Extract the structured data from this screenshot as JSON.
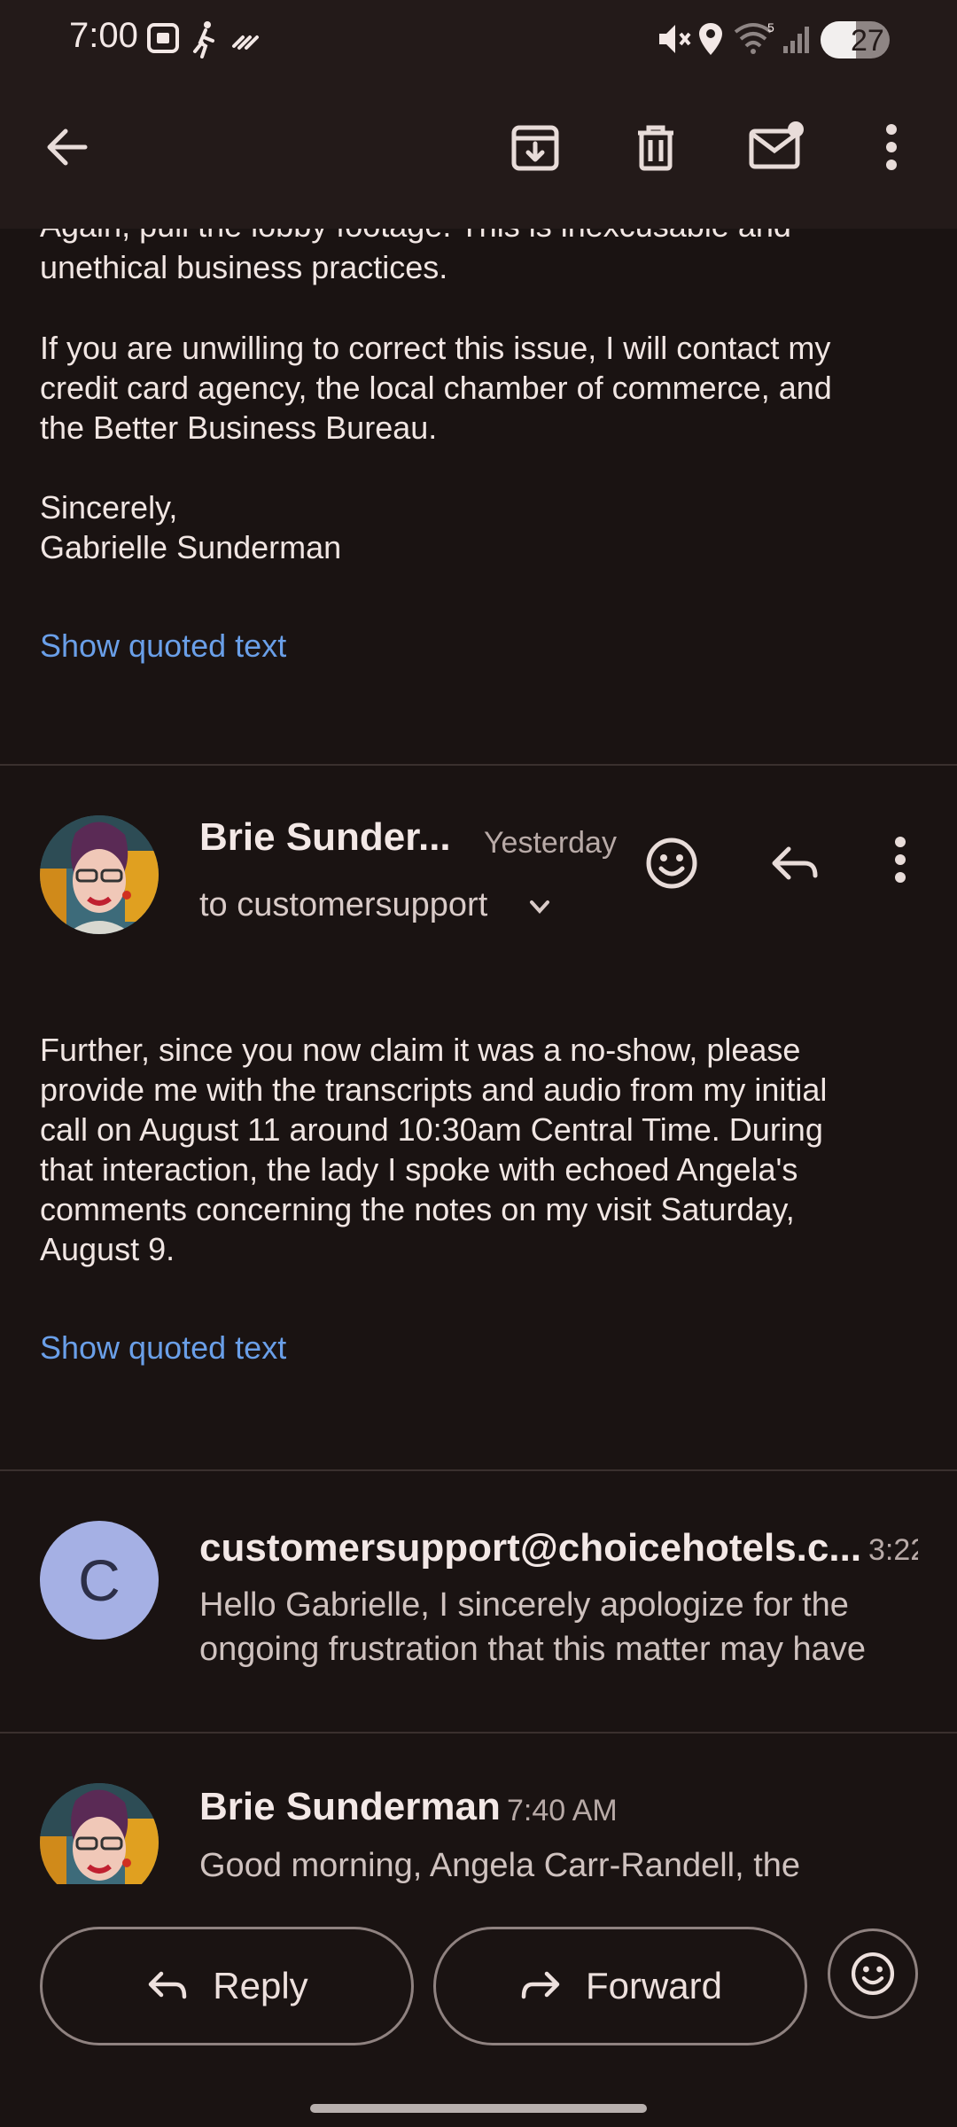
{
  "status_bar": {
    "time": "7:00",
    "battery_level": "27",
    "wifi_label": "5"
  },
  "toolbar": {
    "back_icon": "arrow-left-icon",
    "archive_icon": "archive-icon",
    "delete_icon": "trash-icon",
    "mark_unread_icon": "mail-unread-icon",
    "more_icon": "more-vert-icon"
  },
  "message1": {
    "partial_line": "Again, pull the lobby footage. This is inexcusable and",
    "line2": "unethical business practices.",
    "para2_l1": "If you are unwilling to correct this issue, I will contact my",
    "para2_l2": "credit card agency, the local chamber of commerce, and",
    "para2_l3": "the Better Business Bureau.",
    "closing": "Sincerely,",
    "signature": "Gabrielle Sunderman",
    "show_quoted": "Show quoted text"
  },
  "message2": {
    "sender": "Brie Sunder...",
    "date": "Yesterday",
    "to": "to customersupport",
    "body_l1": "Further, since you now claim it was a no-show, please",
    "body_l2": "provide me with the transcripts and audio from my initial",
    "body_l3": "call on August 11 around 10:30am Central Time. During",
    "body_l4": "that interaction, the lady I spoke with echoed Angela's",
    "body_l5": "comments concerning the notes on my visit Saturday,",
    "body_l6": "August 9.",
    "show_quoted": "Show quoted text"
  },
  "message3": {
    "avatar_letter": "C",
    "sender": "customersupport@choicehotels.c...",
    "time": "3:22",
    "snippet_l1": "Hello Gabrielle, I sincerely apologize for the",
    "snippet_l2": "ongoing frustration that this matter may have"
  },
  "message4": {
    "sender": "Brie Sunderman",
    "time": "7:40 AM",
    "snippet_l1": "Good morning, Angela Carr-Randell, the"
  },
  "actions": {
    "reply": "Reply",
    "forward": "Forward"
  },
  "colors": {
    "background": "#1a1312",
    "link": "#6a9fe8",
    "avatar_c": "#a5b0e4"
  }
}
